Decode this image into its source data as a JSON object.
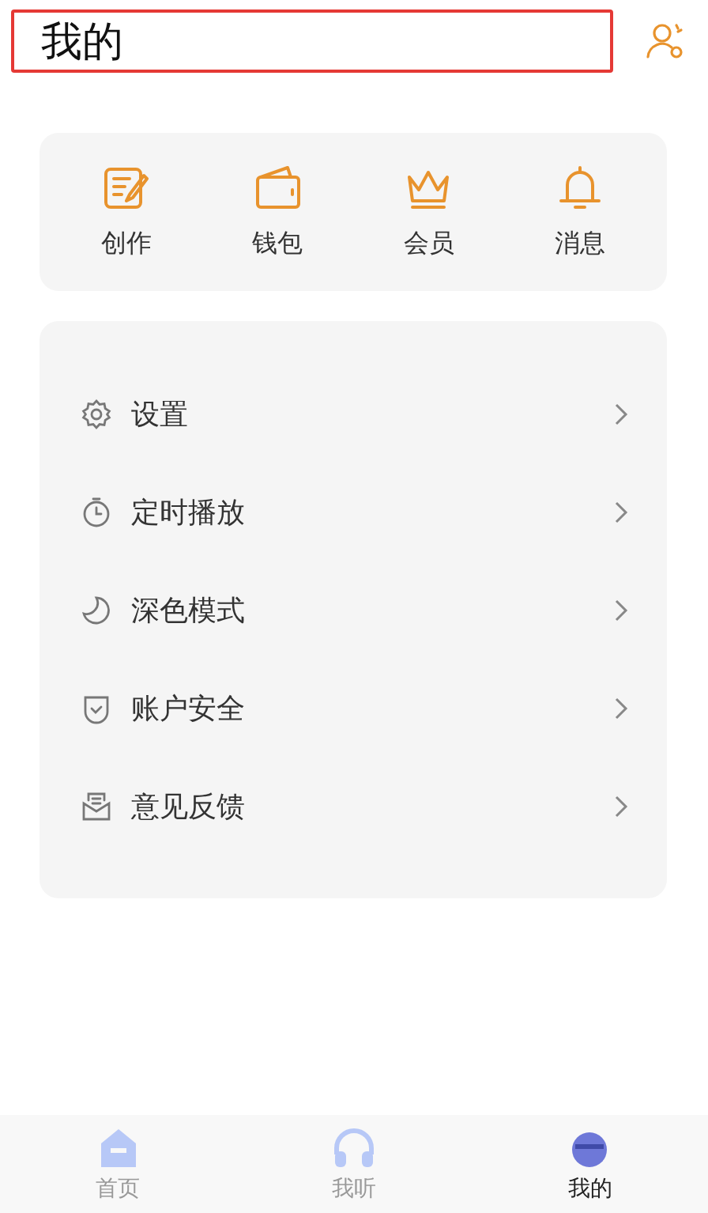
{
  "header": {
    "title": "我的"
  },
  "shortcuts": [
    {
      "kind": "edit",
      "label": "创作"
    },
    {
      "kind": "wallet",
      "label": "钱包"
    },
    {
      "kind": "crown",
      "label": "会员"
    },
    {
      "kind": "bell",
      "label": "消息"
    }
  ],
  "menu": [
    {
      "kind": "gear",
      "label": "设置"
    },
    {
      "kind": "timer",
      "label": "定时播放"
    },
    {
      "kind": "moon",
      "label": "深色模式"
    },
    {
      "kind": "shield",
      "label": "账户安全"
    },
    {
      "kind": "mail",
      "label": "意见反馈"
    }
  ],
  "tab_bar": [
    {
      "kind": "home",
      "label": "首页",
      "selected": false
    },
    {
      "kind": "headphones",
      "label": "我听",
      "selected": false
    },
    {
      "kind": "avatar",
      "label": "我的",
      "selected": true
    }
  ]
}
